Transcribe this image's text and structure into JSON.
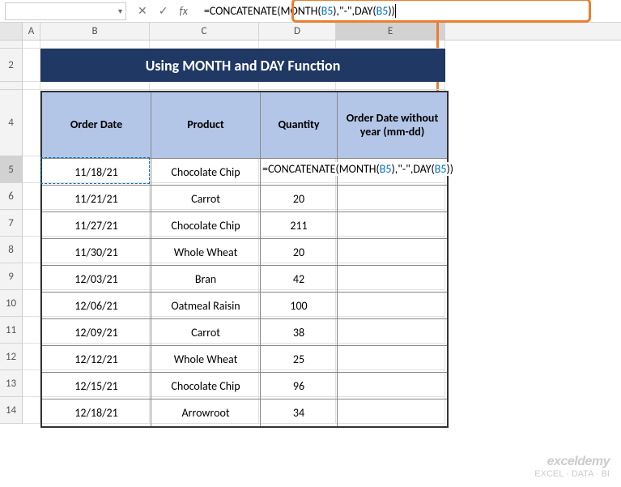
{
  "formula_bar": {
    "name_box_value": "",
    "formula": "=CONCATENATE(MONTH(B5),\"-\",DAY(B5))"
  },
  "columns": [
    "A",
    "B",
    "C",
    "D",
    "E"
  ],
  "title": "Using MONTH and DAY Function",
  "headers": {
    "b": "Order Date",
    "c": "Product",
    "d": "Quantity",
    "e": "Order Date without year (mm-dd)"
  },
  "rows": [
    {
      "n": "5",
      "b": "11/18/21",
      "c": "Chocolate Chip",
      "d": "",
      "e": "=CONCATENATE(MONTH(B5),\"-\",DAY(B5))"
    },
    {
      "n": "6",
      "b": "11/21/21",
      "c": "Carrot",
      "d": "20",
      "e": ""
    },
    {
      "n": "7",
      "b": "11/27/21",
      "c": "Chocolate Chip",
      "d": "211",
      "e": ""
    },
    {
      "n": "8",
      "b": "11/30/21",
      "c": "Whole Wheat",
      "d": "20",
      "e": ""
    },
    {
      "n": "9",
      "b": "12/03/21",
      "c": "Bran",
      "d": "42",
      "e": ""
    },
    {
      "n": "10",
      "b": "12/06/21",
      "c": "Oatmeal Raisin",
      "d": "100",
      "e": ""
    },
    {
      "n": "11",
      "b": "12/09/21",
      "c": "Carrot",
      "d": "38",
      "e": ""
    },
    {
      "n": "12",
      "b": "12/12/21",
      "c": "Whole Wheat",
      "d": "25",
      "e": ""
    },
    {
      "n": "13",
      "b": "12/15/21",
      "c": "Chocolate Chip",
      "d": "96",
      "e": ""
    },
    {
      "n": "14",
      "b": "12/18/21",
      "c": "Arrowroot",
      "d": "34",
      "e": ""
    }
  ],
  "row_labels": [
    "2",
    "4",
    "5",
    "6",
    "7",
    "8",
    "9",
    "10",
    "11",
    "12",
    "13",
    "14"
  ],
  "watermark": {
    "brand": "exceldemy",
    "tag": "EXCEL · DATA · BI"
  },
  "chart_data": {
    "type": "table",
    "title": "Using MONTH and DAY Function",
    "columns": [
      "Order Date",
      "Product",
      "Quantity",
      "Order Date without year (mm-dd)"
    ],
    "rows": [
      [
        "11/18/21",
        "Chocolate Chip",
        null,
        "=CONCATENATE(MONTH(B5),\"-\",DAY(B5))"
      ],
      [
        "11/21/21",
        "Carrot",
        20,
        ""
      ],
      [
        "11/27/21",
        "Chocolate Chip",
        211,
        ""
      ],
      [
        "11/30/21",
        "Whole Wheat",
        20,
        ""
      ],
      [
        "12/03/21",
        "Bran",
        42,
        ""
      ],
      [
        "12/06/21",
        "Oatmeal Raisin",
        100,
        ""
      ],
      [
        "12/09/21",
        "Carrot",
        38,
        ""
      ],
      [
        "12/12/21",
        "Whole Wheat",
        25,
        ""
      ],
      [
        "12/15/21",
        "Chocolate Chip",
        96,
        ""
      ],
      [
        "12/18/21",
        "Arrowroot",
        34,
        ""
      ]
    ]
  }
}
